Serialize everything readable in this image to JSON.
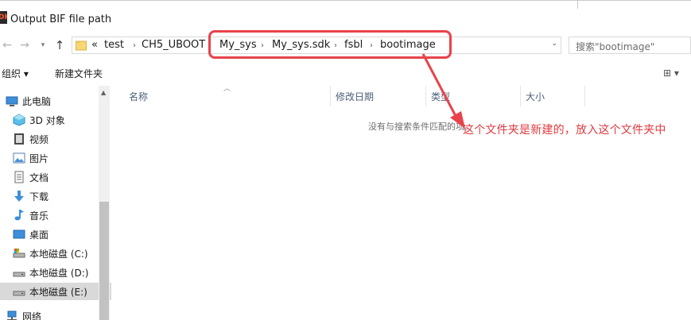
{
  "window": {
    "title": "Output BIF file path",
    "icon_text": "DK"
  },
  "nav": {
    "back_icon": "arrow-left-icon",
    "forward_icon": "arrow-right-icon",
    "recent_icon": "chevron-down-icon",
    "up_icon": "arrow-up-icon"
  },
  "address": {
    "overflow": "«",
    "crumbs": [
      "test",
      "CH5_UBOOT",
      "My_sys",
      "My_sys.sdk",
      "fsbl",
      "bootimage"
    ],
    "separator": "›",
    "dropdown": "⌄"
  },
  "search": {
    "placeholder": "搜索\"bootimage\""
  },
  "toolbar": {
    "organize_label": "组织 ▾",
    "new_folder_label": "新建文件夹",
    "view_icon": "⊞ ▾"
  },
  "sidebar": {
    "items": [
      {
        "label": "此电脑",
        "icon": "pc-icon"
      },
      {
        "label": "3D 对象",
        "icon": "3d-objects-icon"
      },
      {
        "label": "视频",
        "icon": "video-icon"
      },
      {
        "label": "图片",
        "icon": "pictures-icon"
      },
      {
        "label": "文档",
        "icon": "documents-icon"
      },
      {
        "label": "下载",
        "icon": "download-icon"
      },
      {
        "label": "音乐",
        "icon": "music-icon"
      },
      {
        "label": "桌面",
        "icon": "desktop-icon"
      },
      {
        "label": "本地磁盘 (C:)",
        "icon": "drive-c-icon"
      },
      {
        "label": "本地磁盘 (D:)",
        "icon": "drive-icon"
      },
      {
        "label": "本地磁盘 (E:)",
        "icon": "drive-icon"
      },
      {
        "label": "网络",
        "icon": "network-icon"
      }
    ],
    "selected_index": 10
  },
  "columns": {
    "name": "名称",
    "date": "修改日期",
    "type": "类型",
    "size": "大小"
  },
  "content": {
    "empty_message": "没有与搜索条件匹配的项。"
  },
  "annotation": {
    "text": "这个文件夹是新建的，放入这个文件夹中",
    "color": "#e03a3f"
  }
}
